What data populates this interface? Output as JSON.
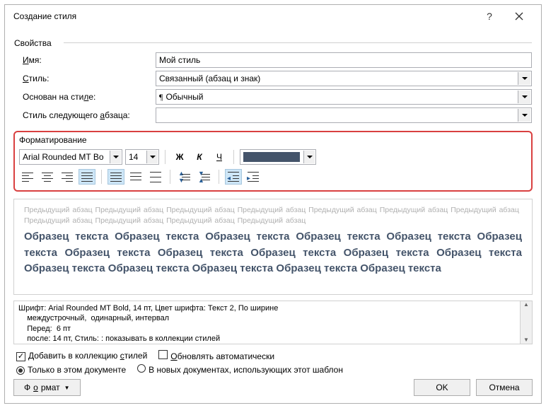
{
  "dialog": {
    "title": "Создание стиля"
  },
  "props": {
    "legend": "Свойства",
    "name_lbl_pre": "",
    "name_u": "И",
    "name_lbl_post": "мя:",
    "style_u": "С",
    "style_post": "тиль:",
    "based_pre": "Основан на сти",
    "based_u": "л",
    "based_post": "е:",
    "next_pre": "Стиль следующего ",
    "next_u": "а",
    "next_post": "бзаца:",
    "name_value": "Мой стиль",
    "style_value": "Связанный (абзац и знак)",
    "based_value": "Обычный",
    "next_value": ""
  },
  "fmt": {
    "legend": "Форматирование",
    "font": "Arial Rounded MT Bo",
    "size": "14",
    "bold": "Ж",
    "italic": "К",
    "underline": "Ч"
  },
  "preview": {
    "prev_word": "Предыдущий абзац",
    "sample_word": "Образец текста"
  },
  "desc": {
    "l1": "Шрифт: Arial Rounded MT Bold, 14 пт, Цвет шрифта: Текст 2, По ширине",
    "l2": "    междустрочный,  одинарный, интервал",
    "l3": "    Перед:  6 пт",
    "l4": "    после: 14 пт, Стиль: : показывать в коллекции стилей"
  },
  "opts": {
    "add_pre": "Добавить в коллекцию ",
    "add_u": "с",
    "add_post": "тилей",
    "auto_pre": "",
    "auto_u": "О",
    "auto_post": "бновлять автоматически",
    "this_doc": "Только в этом документе",
    "tmpl": "В новых документах, использующих этот шаблон"
  },
  "footer": {
    "format_pre": "Ф",
    "format_u": "о",
    "format_post": "рмат",
    "ok": "OK",
    "cancel": "Отмена"
  }
}
